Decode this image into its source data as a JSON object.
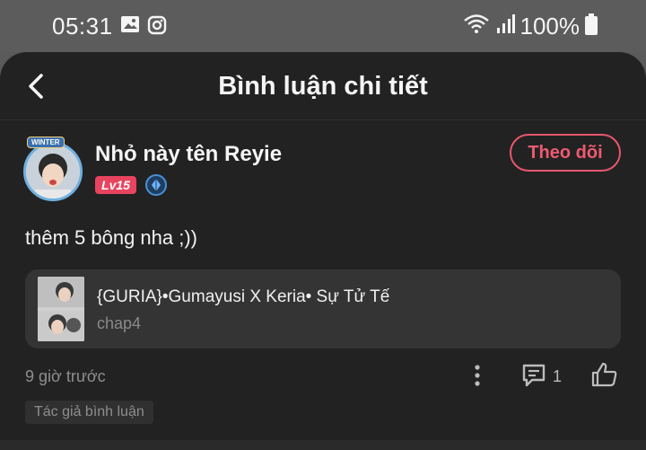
{
  "status_bar": {
    "time": "05:31",
    "left_icons": [
      "image-icon",
      "instagram-icon"
    ],
    "right_icons": [
      "wifi-icon",
      "signal-icon",
      "battery-icon"
    ],
    "battery_percent": "100%"
  },
  "header": {
    "title": "Bình luận chi tiết",
    "back_icon": "chevron-left-icon"
  },
  "comment": {
    "username": "Nhỏ này tên Reyie",
    "avatar_badge": "WINTER",
    "level": "Lv15",
    "follow_label": "Theo dõi",
    "text": "thêm 5 bông nha ;))",
    "story": {
      "title": "{GURIA}•Gumayusi X Keria• Sự Tử Tế",
      "chapter": "chap4"
    },
    "time_ago": "9 giờ trước",
    "reply_count": "1",
    "author_tag": "Tác giả bình luận"
  },
  "colors": {
    "accent": "#e8566d",
    "background": "#222222",
    "card": "#343434",
    "level_badge": "#e8445f"
  }
}
